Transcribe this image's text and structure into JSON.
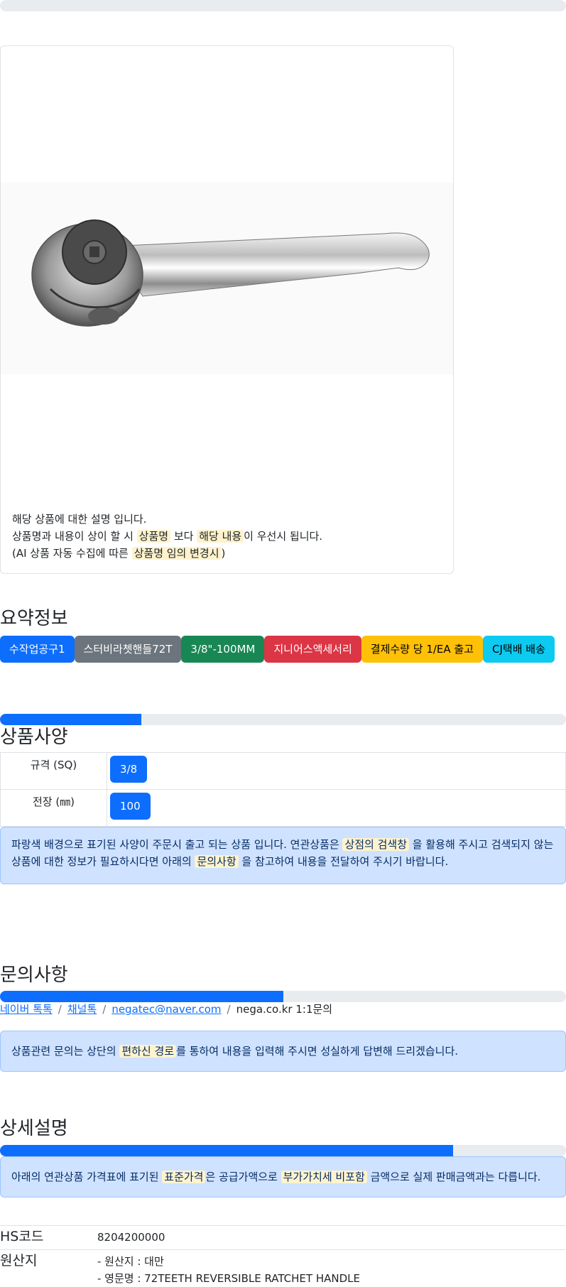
{
  "product": {
    "image_alt": "72TEETH REVERSIBLE RATCHET HANDLE",
    "desc_line1": "해당 상품에 대한 설명 입니다.",
    "desc_line2_a": "상품명과 내용이 상이 할 시 ",
    "desc_line2_hl1": "상품명",
    "desc_line2_b": " 보다 ",
    "desc_line2_hl2": "해당 내용",
    "desc_line2_c": "이 우선시 됩니다.",
    "desc_line3_a": "(AI 상품 자동 수집에 따른 ",
    "desc_line3_hl": "상품명 임의 변경시",
    "desc_line3_b": ")"
  },
  "summary": {
    "title": "요약정보",
    "badges": [
      {
        "label": "수작업공구1",
        "color": "#0d6efd",
        "text_color": "#ffffff"
      },
      {
        "label": "스터비라쳇핸들72T",
        "color": "#6c757d",
        "text_color": "#ffffff"
      },
      {
        "label": "3/8\"-100MM",
        "color": "#198754",
        "text_color": "#ffffff"
      },
      {
        "label": "지니어스액세서리",
        "color": "#dc3545",
        "text_color": "#ffffff"
      },
      {
        "label": "결제수량 당 1/EA 출고",
        "color": "#ffc107",
        "text_color": "#000000"
      },
      {
        "label": "CJ택배 배송",
        "color": "#0dcaf0",
        "text_color": "#000000"
      }
    ]
  },
  "specs": {
    "title": "상품사양",
    "progress": 0.25,
    "rows": [
      {
        "key": "규격 (SQ)",
        "value": "3/8"
      },
      {
        "key": "전장 (㎜)",
        "value": "100"
      }
    ],
    "notice_a": "파랑색 배경으로 표기된 사양이 주문시 출고 되는 상품 입니다. 연관상품은 ",
    "notice_hl1": "상점의 검색창",
    "notice_b": " 을 활용해 주시고 검색되지 않는 상품에 대한 정보가 필요하시다면 아래의 ",
    "notice_hl2": "문의사항",
    "notice_c": " 을 참고하여 내용을 전달하여 주시기 바랍니다."
  },
  "inquiry": {
    "title": "문의사항",
    "progress": 0.5,
    "links": [
      "네이버 톡톡",
      "채널톡",
      "negatec@naver.com"
    ],
    "plain": "nega.co.kr 1:1문의",
    "separator": "/",
    "notice_a": "상품관련 문의는 상단의 ",
    "notice_hl": "편하신 경로",
    "notice_b": "를 통하여 내용을 입력해 주시면 성실하게 답변해 드리겠습니다."
  },
  "detail": {
    "title": "상세설명",
    "progress": 0.8,
    "notice_a": "아래의 연관상품 가격표에 표기된 ",
    "notice_hl1": "표준가격",
    "notice_b": "은 공급가액으로 ",
    "notice_hl2": "부가가치세 비포함",
    "notice_c": " 금액으로 실제 판매금액과는 다릅니다."
  },
  "info": {
    "hs_key": "HS코드",
    "hs_value": "8204200000",
    "origin_key": "원산지",
    "origin_line1": "- 원산지 : 대만",
    "origin_line2": "- 영문명 : 72TEETH REVERSIBLE RATCHET HANDLE"
  }
}
